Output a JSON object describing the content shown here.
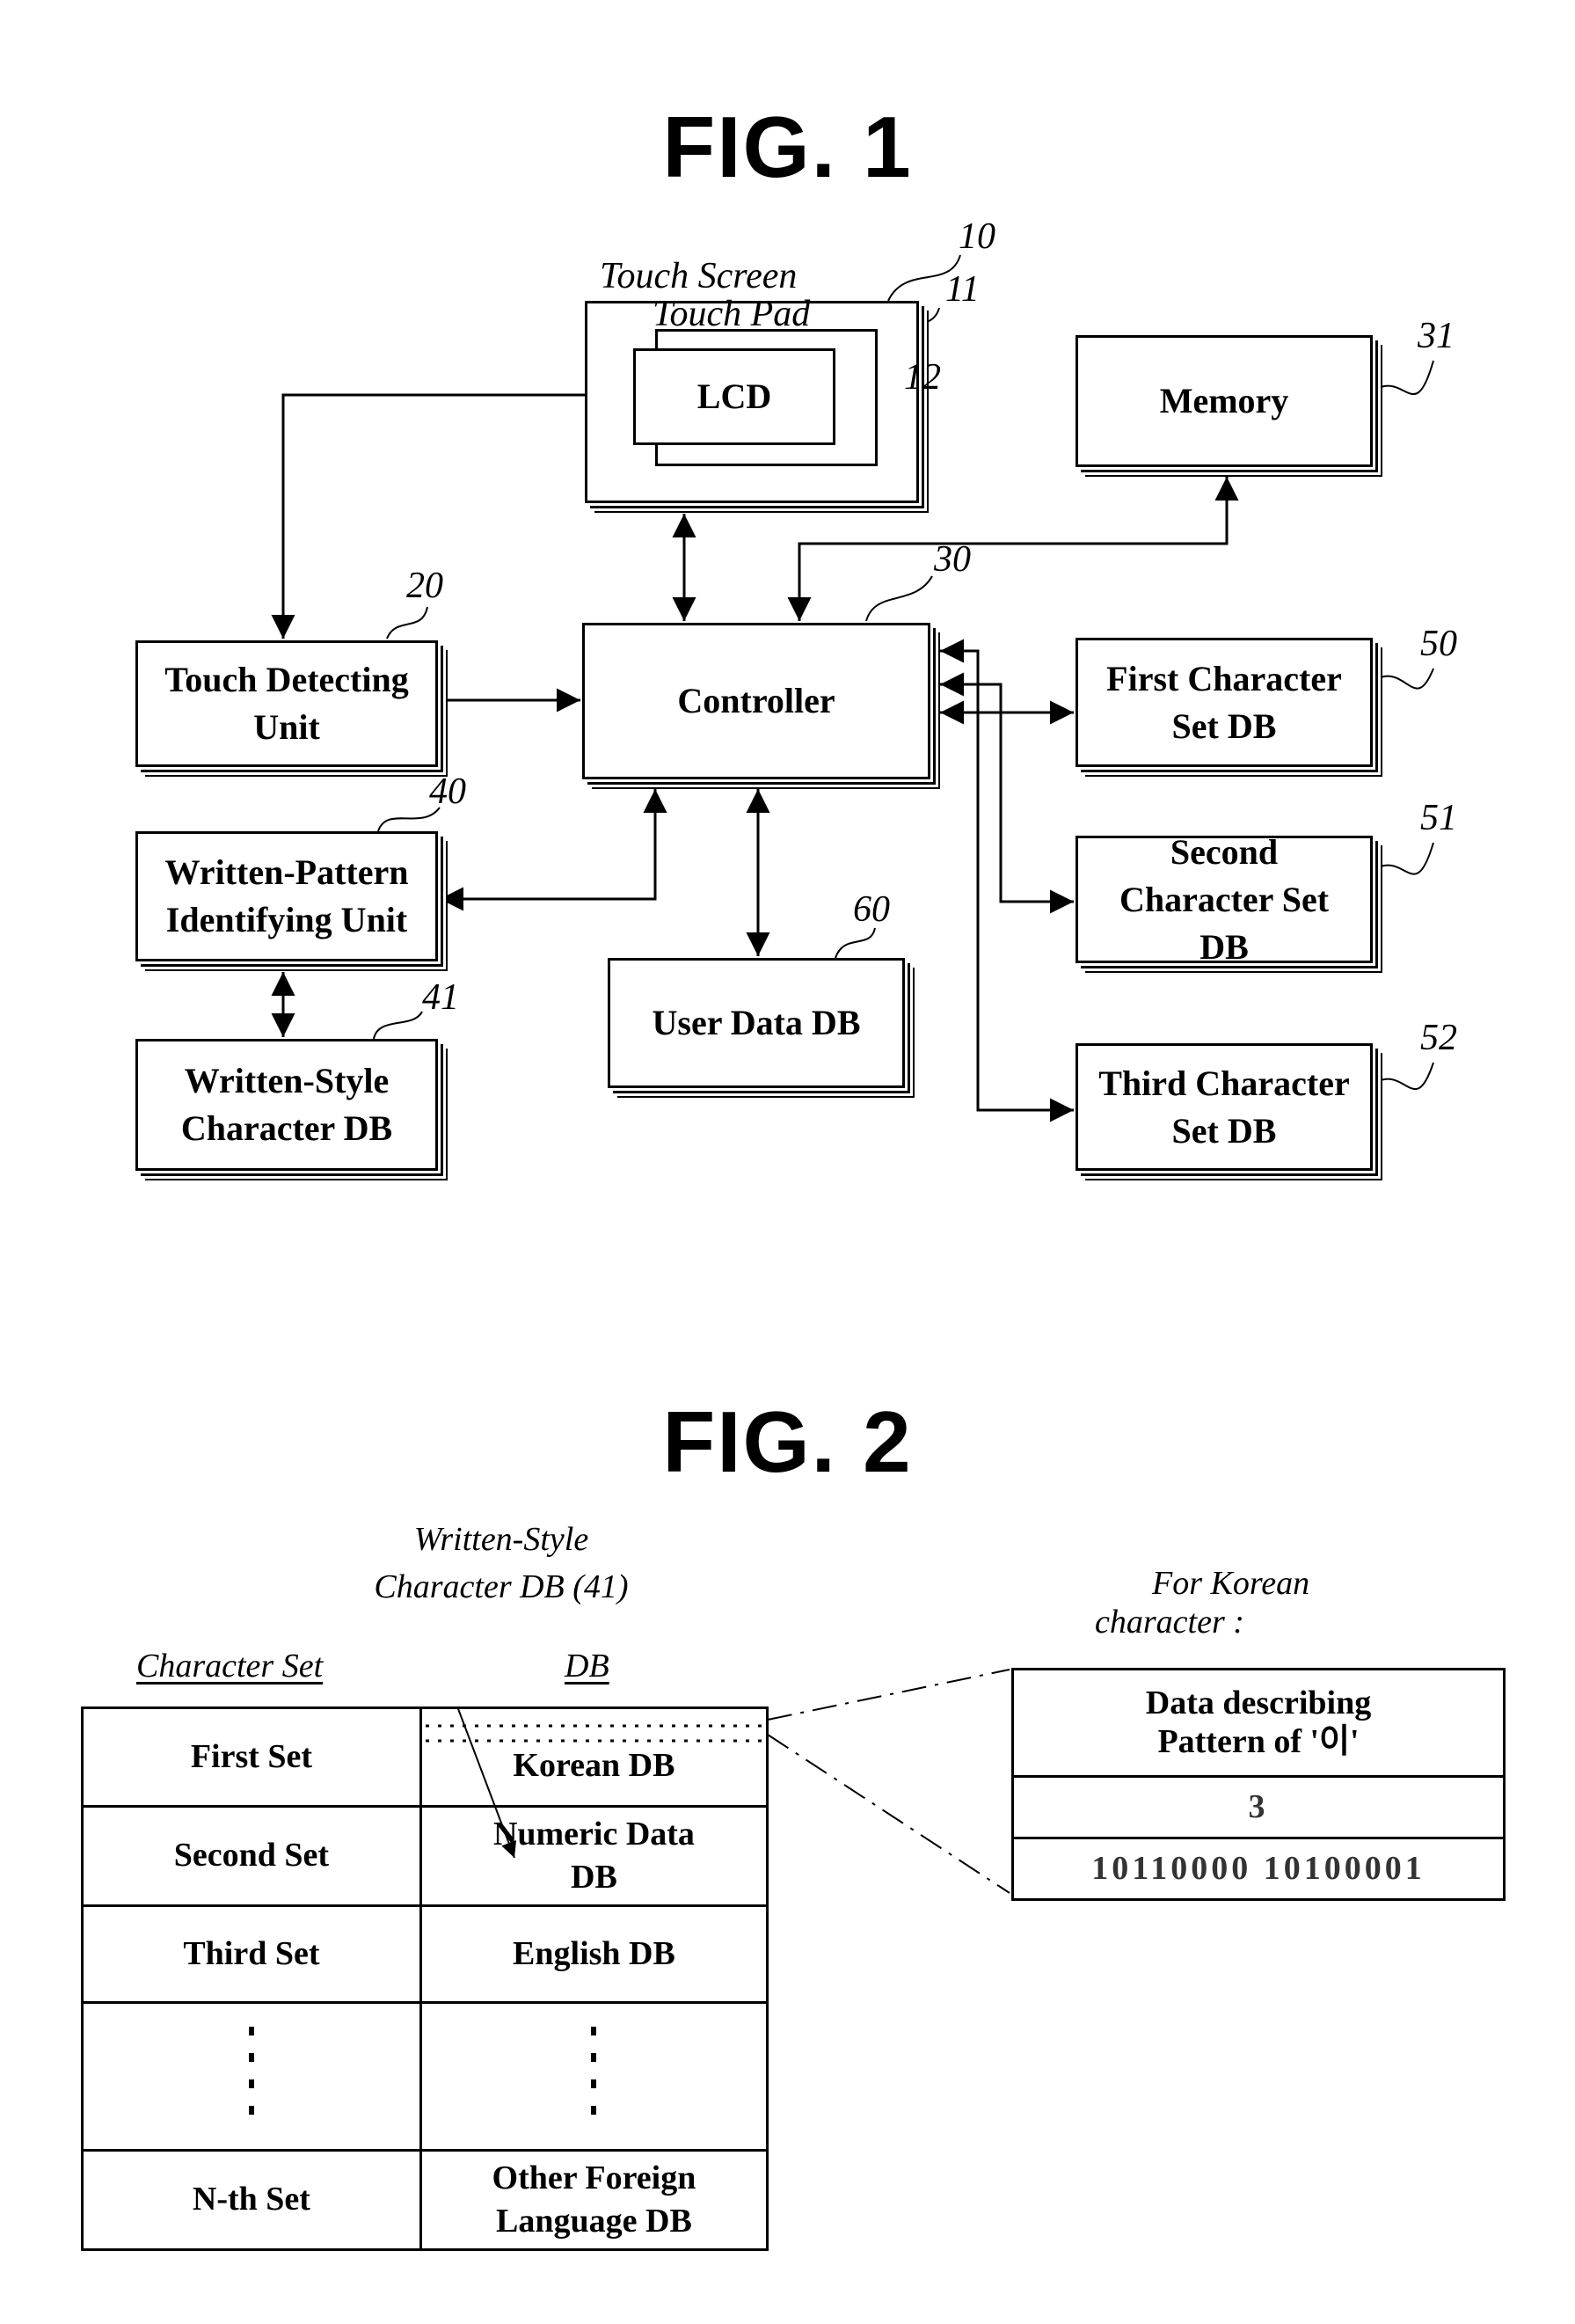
{
  "fig1": {
    "title": "FIG. 1",
    "blocks": {
      "touch_screen": {
        "label": "Touch Screen",
        "ref": "10"
      },
      "touch_pad": {
        "label": "Touch Pad",
        "ref": "11"
      },
      "lcd": {
        "label": "LCD",
        "ref": "12"
      },
      "memory": {
        "label": "Memory",
        "ref": "31"
      },
      "touch_detecting": {
        "label": "Touch Detecting Unit",
        "ref": "20"
      },
      "controller": {
        "label": "Controller",
        "ref": "30"
      },
      "first_char_db": {
        "label": "First Character Set DB",
        "ref": "50"
      },
      "second_char_db": {
        "label": "Second Character Set DB",
        "ref": "51"
      },
      "third_char_db": {
        "label": "Third Character Set DB",
        "ref": "52"
      },
      "written_pattern": {
        "label": "Written-Pattern Identifying Unit",
        "ref": "40"
      },
      "written_style_db": {
        "label": "Written-Style Character DB",
        "ref": "41"
      },
      "user_data_db": {
        "label": "User Data DB",
        "ref": "60"
      }
    },
    "connections": [
      {
        "from": "touch_screen",
        "to": "touch_detecting",
        "direction": "one-way"
      },
      {
        "from": "touch_screen",
        "to": "controller",
        "direction": "two-way"
      },
      {
        "from": "controller",
        "to": "memory",
        "direction": "one-way"
      },
      {
        "from": "touch_detecting",
        "to": "controller",
        "direction": "one-way"
      },
      {
        "from": "controller",
        "to": "first_char_db",
        "direction": "two-way"
      },
      {
        "from": "controller",
        "to": "second_char_db",
        "direction": "two-way"
      },
      {
        "from": "controller",
        "to": "third_char_db",
        "direction": "two-way"
      },
      {
        "from": "controller",
        "to": "written_pattern",
        "direction": "two-way"
      },
      {
        "from": "controller",
        "to": "user_data_db",
        "direction": "two-way"
      },
      {
        "from": "written_pattern",
        "to": "written_style_db",
        "direction": "two-way"
      }
    ]
  },
  "fig2": {
    "title": "FIG. 2",
    "db_callout": {
      "line1": "Written-Style",
      "line2": "Character DB (41)"
    },
    "headers": {
      "character_set": "Character Set",
      "db": "DB"
    },
    "rows": [
      {
        "set": "First Set",
        "db": "Korean DB"
      },
      {
        "set": "Second Set",
        "db": "Numeric Data DB"
      },
      {
        "set": "Third Set",
        "db": "English DB"
      },
      {
        "set": "⋮",
        "db": "⋮"
      },
      {
        "set": "N-th Set",
        "db": "Other Foreign Language DB"
      }
    ],
    "detail": {
      "caption_line1": "For Korean",
      "caption_line2": "character :",
      "header_line1": "Data describing",
      "header_line2": "Pattern of '이'",
      "stroke_count": "3",
      "code": "10110000 10100001"
    }
  }
}
